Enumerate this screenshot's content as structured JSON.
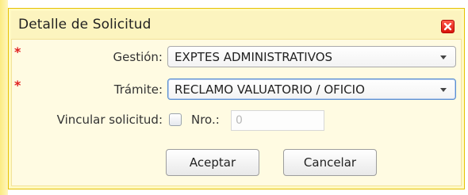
{
  "dialog": {
    "title": "Detalle de Solicitud",
    "close_icon": "close-icon"
  },
  "form": {
    "required_marker": "*",
    "gestion": {
      "label": "Gestión:",
      "value": "EXPTES ADMINISTRATIVOS"
    },
    "tramite": {
      "label": "Trámite:",
      "value": "RECLAMO VALUATORIO / OFICIO"
    },
    "vincular": {
      "label": "Vincular solicitud:",
      "checked": false
    },
    "nro": {
      "label": "Nro.:",
      "value": "0"
    }
  },
  "buttons": {
    "accept_label": "Aceptar",
    "cancel_label": "Cancelar"
  },
  "colors": {
    "frame": "#fcf4bf",
    "close": "#e01e12",
    "required": "#e02020"
  }
}
